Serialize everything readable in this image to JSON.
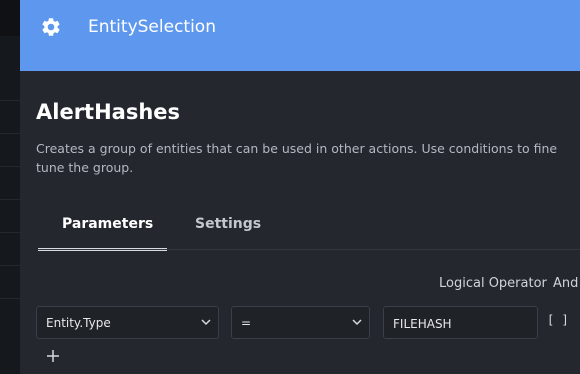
{
  "header": {
    "title": "EntitySelection",
    "icon": "gear-icon"
  },
  "action": {
    "title": "AlertHashes",
    "description": "Creates a group of entities that can be used in other actions. Use conditions to fine tune the group."
  },
  "tabs": [
    {
      "label": "Parameters",
      "active": true
    },
    {
      "label": "Settings",
      "active": false
    }
  ],
  "conditions": {
    "logical_operator_label": "Logical Operator",
    "logical_operator_value": "And",
    "rows": [
      {
        "field": "Entity.Type",
        "operator": "=",
        "value": "FILEHASH",
        "list_toggle": "[ ]"
      }
    ]
  },
  "colors": {
    "header": "#5e98ee",
    "panel": "#24272d",
    "background": "#14171c"
  }
}
